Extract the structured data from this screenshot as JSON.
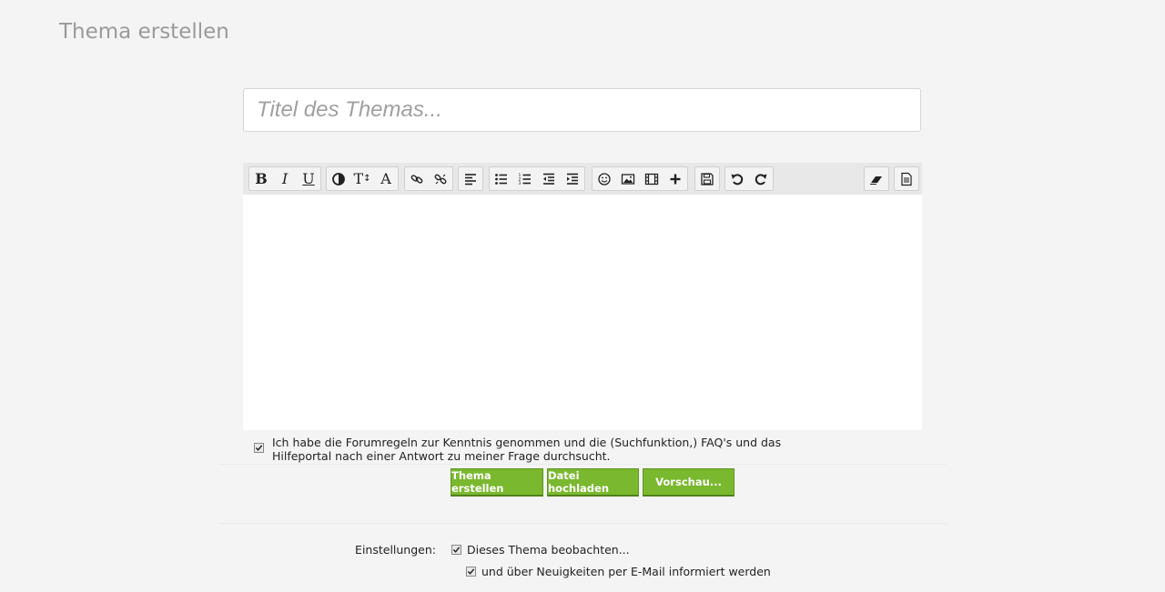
{
  "page": {
    "title": "Thema erstellen"
  },
  "title_input": {
    "placeholder": "Titel des Themas..."
  },
  "toolbar": {
    "bold_label": "B",
    "italic_label": "I",
    "underline_label": "U",
    "font_size_label": "T",
    "font_color_label": "A"
  },
  "rules_checkbox": {
    "checked": true,
    "text": "Ich habe die Forumregeln zur Kenntnis genommen und die (Suchfunktion,) FAQ's und das\nHilfeportal nach einer Antwort zu meiner Frage durchsucht."
  },
  "buttons": {
    "create": "Thema erstellen",
    "upload": "Datei hochladen",
    "preview": "Vorschau..."
  },
  "settings": {
    "label": "Einstellungen:",
    "watch": {
      "checked": true,
      "label": "Dieses Thema beobachten..."
    },
    "email": {
      "checked": true,
      "label": "und über Neuigkeiten per E-Mail informiert werden"
    }
  },
  "colors": {
    "background": "#f4f4f4",
    "button_green": "#7ab82f",
    "page_title": "#9a9a9a"
  }
}
